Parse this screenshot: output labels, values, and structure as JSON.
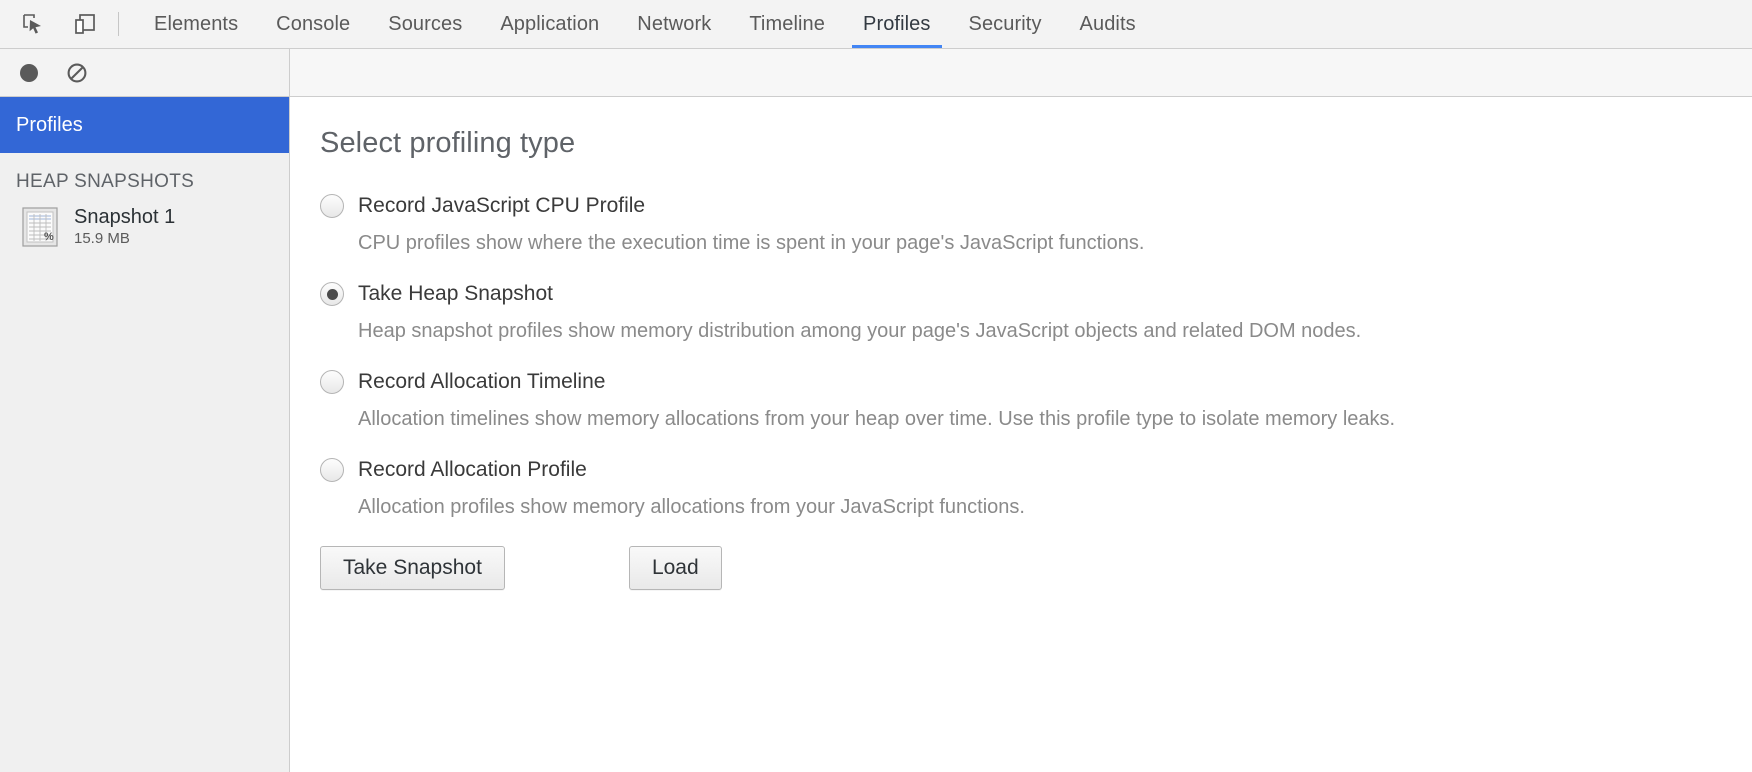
{
  "toolbar": {
    "inspect_icon": "inspect-cursor-icon",
    "device_icon": "device-toolbar-icon",
    "tabs": [
      {
        "label": "Elements",
        "active": false
      },
      {
        "label": "Console",
        "active": false
      },
      {
        "label": "Sources",
        "active": false
      },
      {
        "label": "Application",
        "active": false
      },
      {
        "label": "Network",
        "active": false
      },
      {
        "label": "Timeline",
        "active": false
      },
      {
        "label": "Profiles",
        "active": true
      },
      {
        "label": "Security",
        "active": false
      },
      {
        "label": "Audits",
        "active": false
      }
    ],
    "active_tab": "Profiles",
    "accent_color": "#4285f4"
  },
  "subtoolbar": {
    "record_icon": "record-circle-icon",
    "clear_icon": "clear-prohibited-icon"
  },
  "sidebar": {
    "header_label": "Profiles",
    "header_color": "#3367d6",
    "section_title": "HEAP SNAPSHOTS",
    "snapshots": [
      {
        "icon": "heap-snapshot-grid-icon",
        "name": "Snapshot 1",
        "size": "15.9 MB"
      }
    ]
  },
  "main": {
    "title": "Select profiling type",
    "options": [
      {
        "label": "Record JavaScript CPU Profile",
        "description": "CPU profiles show where the execution time is spent in your page's JavaScript functions.",
        "selected": false
      },
      {
        "label": "Take Heap Snapshot",
        "description": "Heap snapshot profiles show memory distribution among your page's JavaScript objects and related DOM nodes.",
        "selected": true
      },
      {
        "label": "Record Allocation Timeline",
        "description": "Allocation timelines show memory allocations from your heap over time. Use this profile type to isolate memory leaks.",
        "selected": false
      },
      {
        "label": "Record Allocation Profile",
        "description": "Allocation profiles show memory allocations from your JavaScript functions.",
        "selected": false
      }
    ],
    "primary_button": "Take Snapshot",
    "secondary_button": "Load"
  }
}
